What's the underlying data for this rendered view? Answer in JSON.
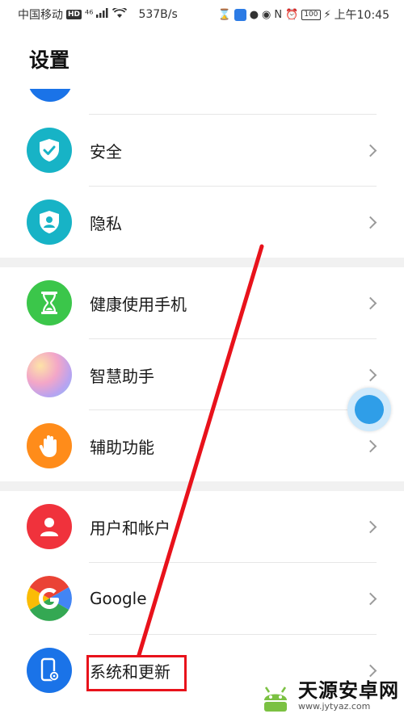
{
  "status_bar": {
    "carrier": "中国移动",
    "hd": "HD",
    "network": "⁴⁶",
    "speed": "537B/s",
    "battery": "100",
    "time": "上午10:45",
    "icons": [
      "signal-icon",
      "wifi-icon",
      "hourglass-icon",
      "app-icon",
      "wechat-icon",
      "eye-icon",
      "nfc-icon",
      "alarm-icon",
      "battery-icon",
      "charging-icon"
    ]
  },
  "page": {
    "title": "设置"
  },
  "settings_items": [
    {
      "label": "安全",
      "icon": "shield-icon",
      "color": "#17b3c6"
    },
    {
      "label": "隐私",
      "icon": "privacy-person-icon",
      "color": "#17b3c6"
    },
    {
      "label": "健康使用手机",
      "icon": "hourglass-icon",
      "color": "#3bc64a"
    },
    {
      "label": "智慧助手",
      "icon": "assistant-icon",
      "color": "#b9a3f0"
    },
    {
      "label": "辅助功能",
      "icon": "hand-icon",
      "color": "#ff8c1a"
    },
    {
      "label": "用户和帐户",
      "icon": "user-icon",
      "color": "#f0323c"
    },
    {
      "label": "Google",
      "icon": "google-icon",
      "color": "#ffffff"
    },
    {
      "label": "系统和更新",
      "icon": "phone-settings-icon",
      "color": "#1a73e8"
    }
  ],
  "watermark": {
    "title": "天源安卓网",
    "url": "www.jytyaz.com"
  }
}
